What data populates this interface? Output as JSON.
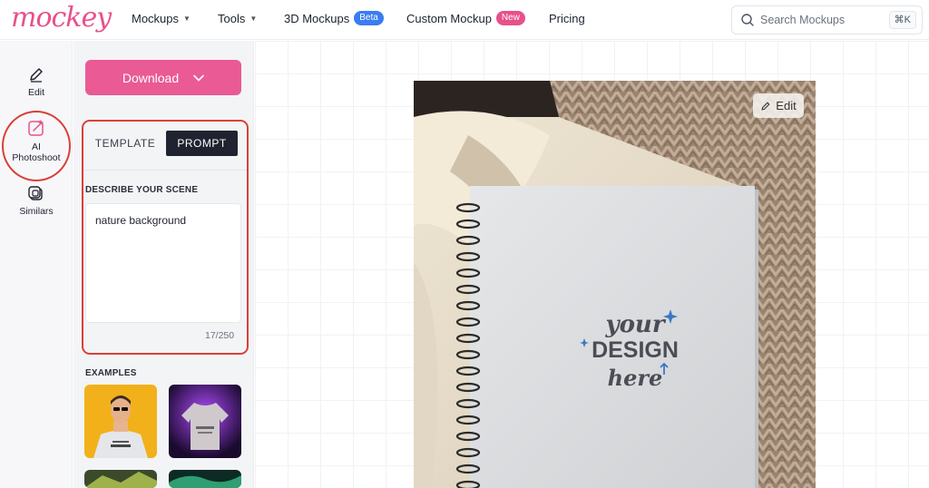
{
  "brand": {
    "logo_text": "mockey"
  },
  "nav": {
    "mockups": "Mockups",
    "tools": "Tools",
    "mockups_3d": "3D Mockups",
    "beta_badge": "Beta",
    "custom_mockup": "Custom Mockup",
    "new_badge": "New",
    "pricing": "Pricing"
  },
  "search": {
    "placeholder": "Search Mockups",
    "shortcut": "⌘K"
  },
  "rail": {
    "edit": "Edit",
    "ai_photoshoot_line1": "AI",
    "ai_photoshoot_line2": "Photoshoot",
    "similars": "Similars"
  },
  "panel": {
    "download_label": "Download",
    "tab_template": "TEMPLATE",
    "tab_prompt": "PROMPT",
    "describe_label": "DESCRIBE YOUR SCENE",
    "prompt_value": "nature background",
    "char_count": "17/250",
    "examples_label": "EXAMPLES"
  },
  "canvas": {
    "edit_label": "Edit",
    "design_line1": "your",
    "design_line2": "DESIGN",
    "design_line3": "here"
  },
  "colors": {
    "brand_pink": "#e8508b",
    "download_pink": "#ea5a94",
    "highlight_red": "#d9403a",
    "beta_blue": "#3a7cf2",
    "dark": "#1f2330"
  },
  "icons": [
    "search-icon",
    "chevron-down-icon",
    "pencil-icon",
    "ai-photoshoot-icon",
    "similars-icon"
  ]
}
